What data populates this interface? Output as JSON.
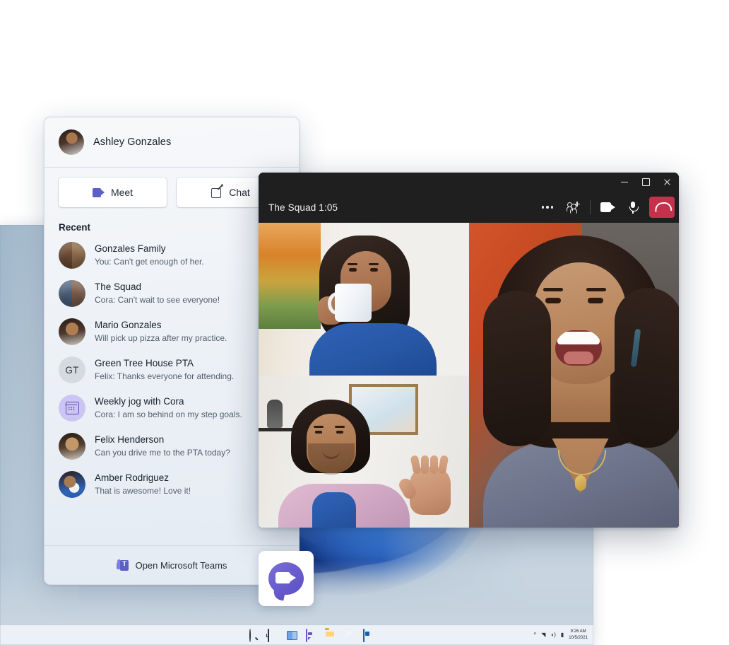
{
  "flyout": {
    "user": {
      "name": "Ashley Gonzales",
      "avatar_icon": "user-avatar"
    },
    "actions": [
      {
        "label": "Meet",
        "icon": "video-camera-icon"
      },
      {
        "label": "Chat",
        "icon": "compose-chat-icon"
      }
    ],
    "section_title": "Recent",
    "recent": [
      {
        "title": "Gonzales Family",
        "preview": "You: Can't get enough of her.",
        "avatar_type": "group-photo"
      },
      {
        "title": "The Squad",
        "preview": "Cora: Can't wait to see everyone!",
        "avatar_type": "group-photo"
      },
      {
        "title": "Mario Gonzales",
        "preview": "Will pick up pizza after my practice.",
        "avatar_type": "photo"
      },
      {
        "title": "Green Tree House PTA",
        "preview": "Felix: Thanks everyone for attending.",
        "avatar_type": "initials",
        "initials": "GT"
      },
      {
        "title": "Weekly jog with Cora",
        "preview": "Cora: I am so behind on my step goals.",
        "avatar_type": "calendar-icon"
      },
      {
        "title": "Felix Henderson",
        "preview": "Can you drive me to the PTA today?",
        "avatar_type": "photo"
      },
      {
        "title": "Amber Rodriguez",
        "preview": "That is awesome! Love it!",
        "avatar_type": "photo"
      }
    ],
    "footer": {
      "label": "Open Microsoft Teams",
      "icon": "microsoft-teams-logo"
    }
  },
  "call_window": {
    "title": "The Squad 1:05",
    "window_controls": [
      {
        "name": "minimize",
        "glyph": "–"
      },
      {
        "name": "maximize",
        "glyph": "□"
      },
      {
        "name": "close",
        "glyph": "×"
      }
    ],
    "toolbar": [
      {
        "name": "more-options",
        "icon": "ellipsis-icon"
      },
      {
        "name": "add-people",
        "icon": "add-people-icon"
      },
      {
        "name": "camera",
        "icon": "video-camera-icon"
      },
      {
        "name": "microphone",
        "icon": "microphone-icon"
      },
      {
        "name": "hang-up",
        "icon": "end-call-icon"
      }
    ],
    "hangup_color": "#c4314b",
    "participants": [
      {
        "position": "left-top",
        "description": "woman drinking from mug"
      },
      {
        "position": "left-bottom",
        "description": "man waving"
      },
      {
        "position": "right",
        "description": "woman laughing"
      }
    ]
  },
  "desktop": {
    "wallpaper": "windows-11-bloom",
    "chat_app_tile": {
      "icon": "chat-bubble-video-icon"
    },
    "taskbar": {
      "icons": [
        {
          "name": "start",
          "label": "Start"
        },
        {
          "name": "search",
          "label": "Search"
        },
        {
          "name": "task-view",
          "label": "Task View"
        },
        {
          "name": "widgets",
          "label": "Widgets"
        },
        {
          "name": "chat",
          "label": "Chat"
        },
        {
          "name": "file-explorer",
          "label": "File Explorer"
        },
        {
          "name": "edge",
          "label": "Microsoft Edge"
        },
        {
          "name": "store",
          "label": "Microsoft Store"
        }
      ],
      "tray": {
        "chevron": "^",
        "wifi": "wifi-icon",
        "volume": "volume-icon",
        "battery": "battery-icon"
      },
      "clock": {
        "time": "9:26 AM",
        "date": "10/5/2021"
      }
    }
  },
  "colors": {
    "teams_purple": "#5b5fc7",
    "hangup_red": "#c4314b",
    "windows_blue": "#2f6fd6"
  }
}
